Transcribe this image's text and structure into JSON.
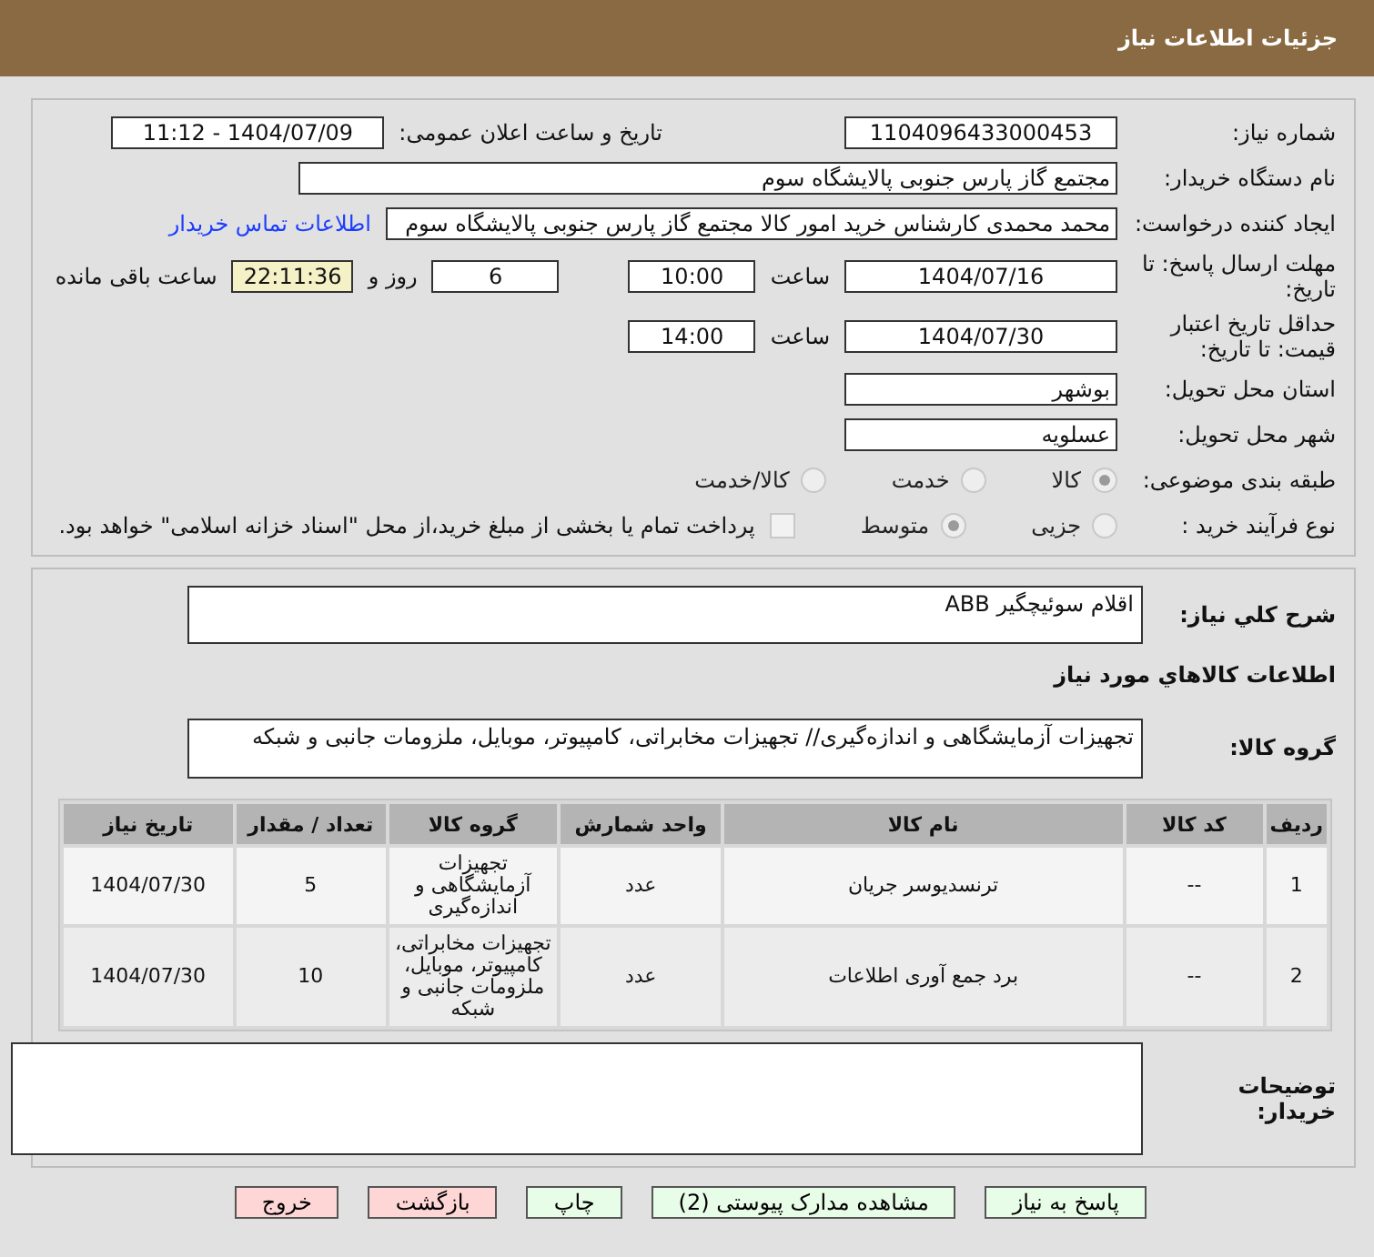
{
  "header": {
    "title": "جزئیات اطلاعات نیاز"
  },
  "need_number": {
    "label": "شماره نیاز:",
    "value": "1104096433000453"
  },
  "announce": {
    "label": "تاریخ و ساعت اعلان عمومی:",
    "value": "1404/07/09 - 11:12"
  },
  "buyer_org": {
    "label": "نام دستگاه خریدار:",
    "value": "مجتمع گاز پارس جنوبی  پالایشگاه سوم"
  },
  "requester": {
    "label": "ایجاد کننده درخواست:",
    "value": "محمد محمدی کارشناس خرید امور کالا مجتمع گاز پارس جنوبی  پالایشگاه سوم",
    "link": "اطلاعات تماس خریدار"
  },
  "deadline": {
    "label": "مهلت ارسال پاسخ: تا تاریخ:",
    "date": "1404/07/16",
    "time_label": "ساعت",
    "time": "10:00",
    "days": "6",
    "days_label": "روز و",
    "remaining": "22:11:36",
    "remaining_label": "ساعت باقی مانده"
  },
  "validity": {
    "label": "حداقل تاریخ اعتبار قیمت: تا تاریخ:",
    "date": "1404/07/30",
    "time_label": "ساعت",
    "time": "14:00"
  },
  "province": {
    "label": "استان محل تحویل:",
    "value": "بوشهر"
  },
  "city": {
    "label": "شهر محل تحویل:",
    "value": "عسلویه"
  },
  "category": {
    "label": "طبقه بندی موضوعی:",
    "options": [
      {
        "label": "کالا",
        "selected": true
      },
      {
        "label": "خدمت",
        "selected": false
      },
      {
        "label": "کالا/خدمت",
        "selected": false
      }
    ]
  },
  "process": {
    "label": "نوع فرآیند خرید :",
    "options": [
      {
        "label": "جزیی",
        "selected": false
      },
      {
        "label": "متوسط",
        "selected": true
      }
    ],
    "note": {
      "label": "پرداخت تمام یا بخشی از مبلغ خرید،از محل \"اسناد خزانه اسلامی\" خواهد بود.",
      "checked": false
    }
  },
  "description": {
    "label": "شرح کلي نياز:",
    "value": "اقلام سوئیچگیر ABB"
  },
  "items_title": "اطلاعات کالاهاي مورد نياز",
  "goods_group": {
    "label": "گروه کالا:",
    "value": "تجهیزات آزمایشگاهی و اندازه‌گیری// تجهیزات مخابراتی، کامپیوتر، موبایل، ملزومات جانبی و شبکه"
  },
  "table": {
    "columns": [
      "ردیف",
      "کد کالا",
      "نام کالا",
      "واحد شمارش",
      "گروه کالا",
      "تعداد / مقدار",
      "تاریخ نیاز"
    ],
    "rows": [
      [
        "1",
        "--",
        "ترنسدیوسر جریان",
        "عدد",
        "تجهیزات آزمایشگاهی و اندازه‌گیری",
        "5",
        "1404/07/30"
      ],
      [
        "2",
        "--",
        "برد جمع آوری اطلاعات",
        "عدد",
        "تجهیزات مخابراتی، کامپیوتر، موبایل، ملزومات جانبی و شبکه",
        "10",
        "1404/07/30"
      ]
    ]
  },
  "buyer_notes": {
    "label": "توضیحات خریدار:"
  },
  "buttons": [
    {
      "label": "پاسخ به نیاز",
      "kind": "primary"
    },
    {
      "label": "مشاهده مدارک پیوستی (2)",
      "kind": "primary"
    },
    {
      "label": "چاپ",
      "kind": "primary"
    },
    {
      "label": "بازگشت",
      "kind": "danger"
    },
    {
      "label": "خروج",
      "kind": "danger"
    }
  ]
}
